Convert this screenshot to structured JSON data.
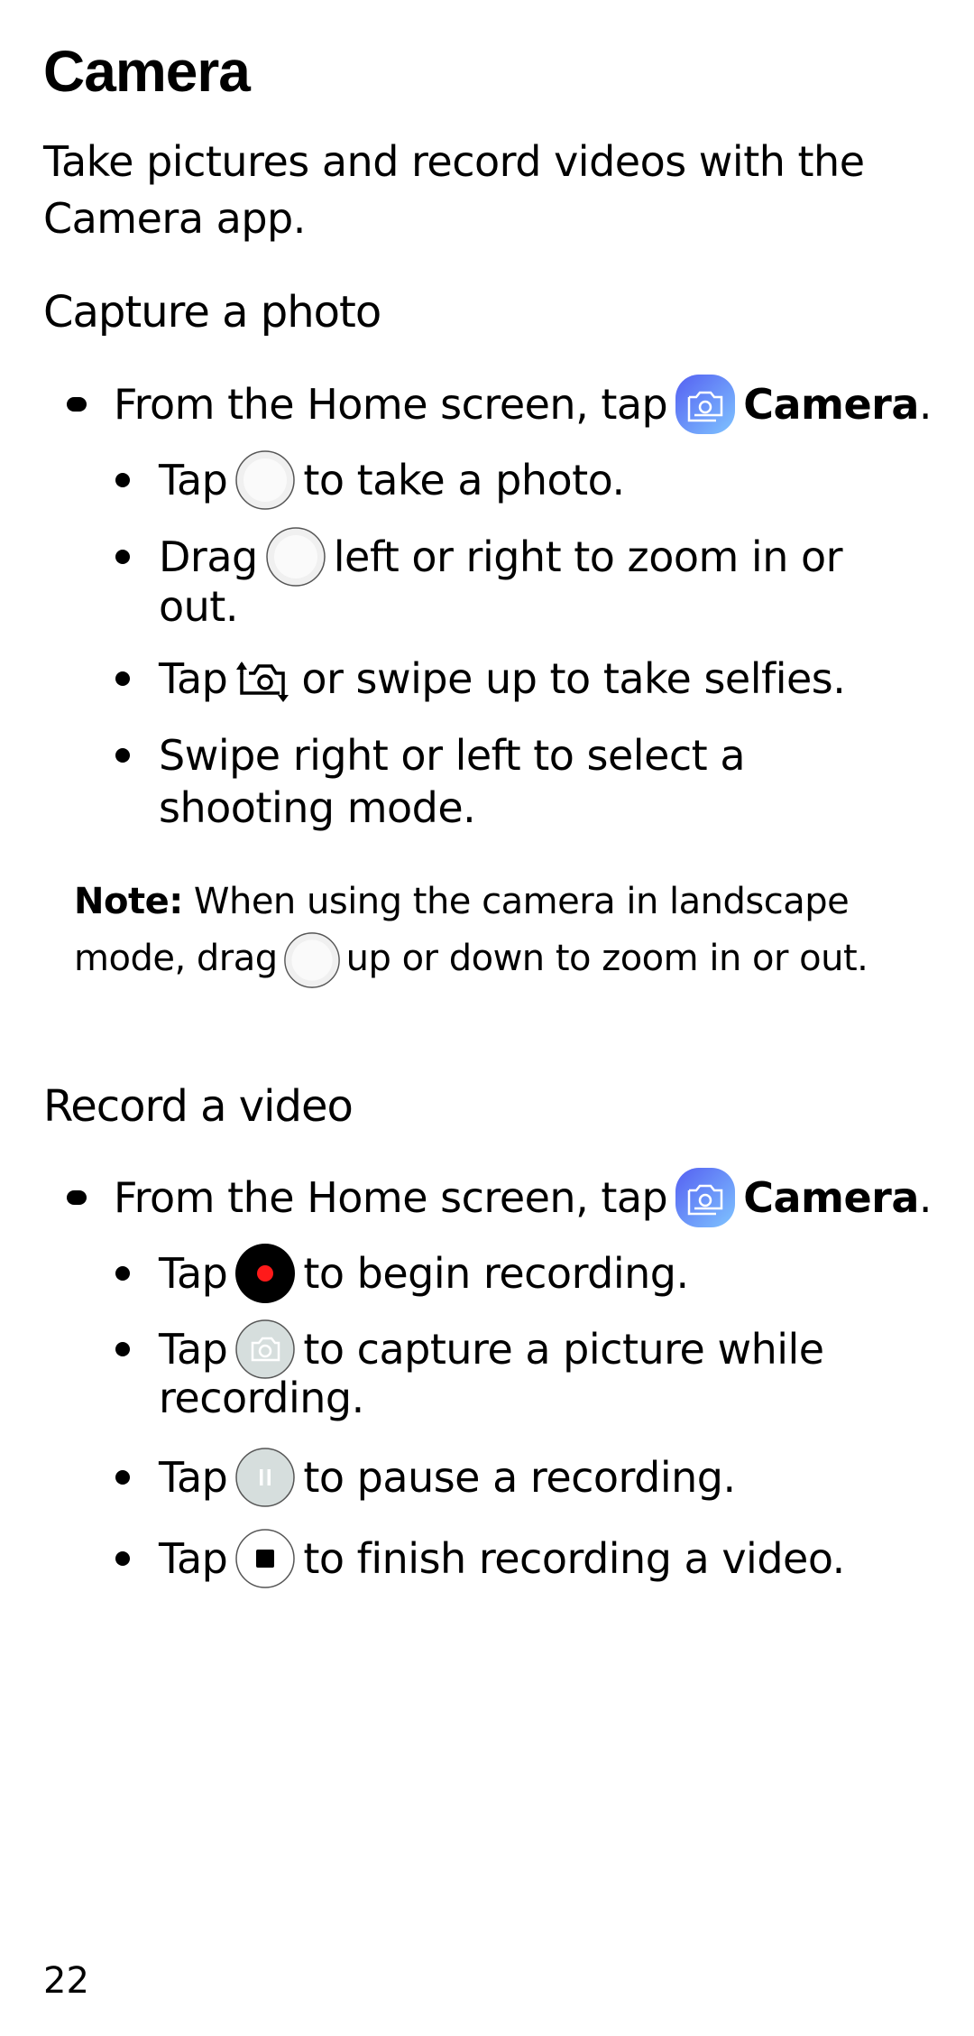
{
  "page": {
    "title": "Camera",
    "intro": "Take pictures and record videos with the Camera app.",
    "page_number": "22"
  },
  "capture_photo": {
    "heading": "Capture a photo",
    "step1": {
      "prefix": "From the Home screen, tap",
      "app_icon": "camera-app-icon",
      "app_name": "Camera",
      "suffix": "."
    },
    "substeps": [
      {
        "prefix": "Tap",
        "icon": "shutter-button-icon",
        "text": "to take a photo."
      },
      {
        "prefix": "Drag",
        "icon": "shutter-button-icon",
        "text": "left or right to zoom in or",
        "cont": "out."
      },
      {
        "prefix": "Tap",
        "icon": "switch-camera-icon",
        "text": "or swipe up to take selfies."
      },
      {
        "text": "Swipe right or left to select a",
        "cont": "shooting mode."
      }
    ],
    "note": {
      "label": "Note:",
      "text_before": "When using the camera in landscape mode, drag",
      "icon": "shutter-button-icon",
      "text_after": "up or down to zoom in or out."
    }
  },
  "record_video": {
    "heading": "Record a video",
    "step1": {
      "prefix": "From the Home screen, tap",
      "app_icon": "camera-app-icon",
      "app_name": "Camera",
      "suffix": "."
    },
    "substeps": [
      {
        "prefix": "Tap",
        "icon": "record-button-icon",
        "text": "to begin recording."
      },
      {
        "prefix": "Tap",
        "icon": "capture-while-recording-icon",
        "text": "to capture a picture while",
        "cont": "recording."
      },
      {
        "prefix": "Tap",
        "icon": "pause-button-icon",
        "text": "to pause a recording."
      },
      {
        "prefix": "Tap",
        "icon": "stop-button-icon",
        "text": "to finish recording a video."
      }
    ]
  },
  "colors": {
    "app_icon_gradient_start": "#5a6cf5",
    "app_icon_gradient_end": "#7bbcff",
    "record_dot": "#ff1a1a",
    "muted_button_fill": "#d6dedd",
    "shutter_ring": "#f0f0f0"
  }
}
